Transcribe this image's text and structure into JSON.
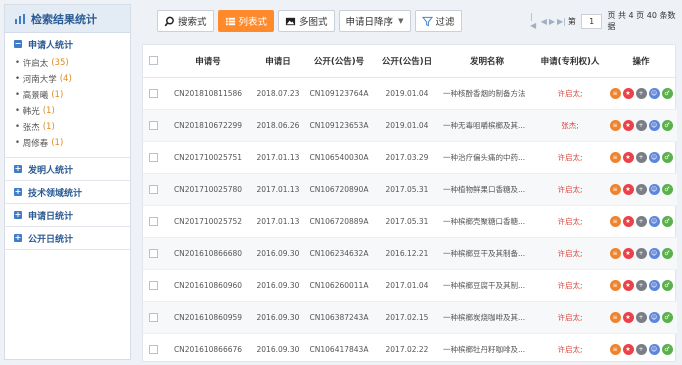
{
  "sidebar": {
    "title": "检索结果统计",
    "sections": [
      {
        "title": "申请人统计",
        "expanded": true,
        "items": [
          {
            "name": "许启太",
            "count": "(35)"
          },
          {
            "name": "河南大学",
            "count": "(4)"
          },
          {
            "name": "高景曦",
            "count": "(1)"
          },
          {
            "name": "韩光",
            "count": "(1)"
          },
          {
            "name": "张杰",
            "count": "(1)"
          },
          {
            "name": "周修春",
            "count": "(1)"
          }
        ]
      },
      {
        "title": "发明人统计",
        "expanded": false
      },
      {
        "title": "技术领域统计",
        "expanded": false
      },
      {
        "title": "申请日统计",
        "expanded": false
      },
      {
        "title": "公开日统计",
        "expanded": false
      }
    ]
  },
  "toolbar": {
    "search_view": "搜索式",
    "list_view": "列表式",
    "grid_view": "多图式",
    "sort": "申请日降序",
    "filter": "过滤"
  },
  "pager": {
    "prefix": "第",
    "page": "1",
    "suffix": "页 共 4 页 40 条数据"
  },
  "table": {
    "headers": [
      "申请号",
      "申请日",
      "公开(公告)号",
      "公开(公告)日",
      "发明名称",
      "申请(专利权)人",
      "操作"
    ],
    "rows": [
      [
        "CN201810811586",
        "2018.07.23",
        "CN109123764A",
        "2019.01.04",
        "一种核酚香烟的制备方法",
        "许启太;"
      ],
      [
        "CN201810672299",
        "2018.06.26",
        "CN109123653A",
        "2019.01.04",
        "一种无毒咀嚼槟榔及其...",
        "张杰;"
      ],
      [
        "CN201710025751",
        "2017.01.13",
        "CN106540030A",
        "2017.03.29",
        "一种治疗偏头痛的中药...",
        "许启太;"
      ],
      [
        "CN201710025780",
        "2017.01.13",
        "CN106720890A",
        "2017.05.31",
        "一种植物鲜果口香糖及...",
        "许启太;"
      ],
      [
        "CN201710025752",
        "2017.01.13",
        "CN106720889A",
        "2017.05.31",
        "一种槟榔壳聚糖口香糖...",
        "许启太;"
      ],
      [
        "CN201610866680",
        "2016.09.30",
        "CN106234632A",
        "2016.12.21",
        "一种槟榔豆干及其制备...",
        "许启太;"
      ],
      [
        "CN201610860960",
        "2016.09.30",
        "CN106260011A",
        "2017.01.04",
        "一种槟榔豆腐干及其制...",
        "许启太;"
      ],
      [
        "CN201610860959",
        "2016.09.30",
        "CN106387243A",
        "2017.02.15",
        "一种槟榔炭烧咖啡及其...",
        "许启太;"
      ],
      [
        "CN201610866676",
        "2016.09.30",
        "CN106417843A",
        "2017.02.22",
        "一种槟榔牡丹籽咖啡及...",
        "许启太;"
      ]
    ],
    "person_color": "#e0453b"
  },
  "colors": {
    "accent": "#ff8a2b",
    "brand": "#2b5b93"
  },
  "icons": {
    "op_buttons": [
      "detail-icon",
      "favorite-icon",
      "add-icon",
      "user-icon",
      "male-icon"
    ]
  }
}
